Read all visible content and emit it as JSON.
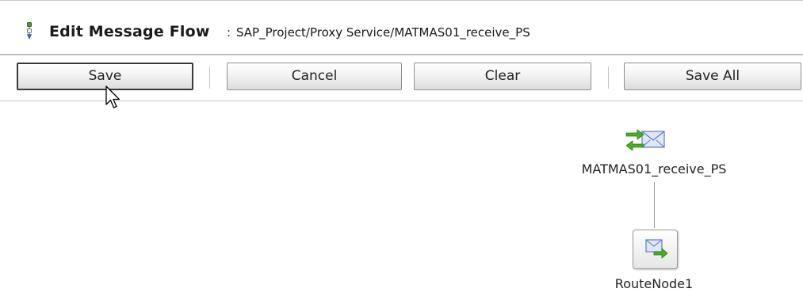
{
  "header": {
    "icon": "message-flow-icon",
    "title": "Edit Message Flow",
    "separator": ":",
    "path": "SAP_Project/Proxy Service/MATMAS01_receive_PS"
  },
  "toolbar": {
    "save_label": "Save",
    "cancel_label": "Cancel",
    "clear_label": "Clear",
    "save_all_label": "Save All"
  },
  "flow": {
    "proxy_node": {
      "label": "MATMAS01_receive_PS",
      "icon": "proxy-service-icon"
    },
    "route_node": {
      "label": "RouteNode1",
      "icon": "route-node-icon"
    }
  },
  "colors": {
    "accent_green": "#3aa21a",
    "envelope_blue": "#6f8fd6",
    "button_border": "#8f8f8f",
    "divider": "#b9bec7"
  }
}
